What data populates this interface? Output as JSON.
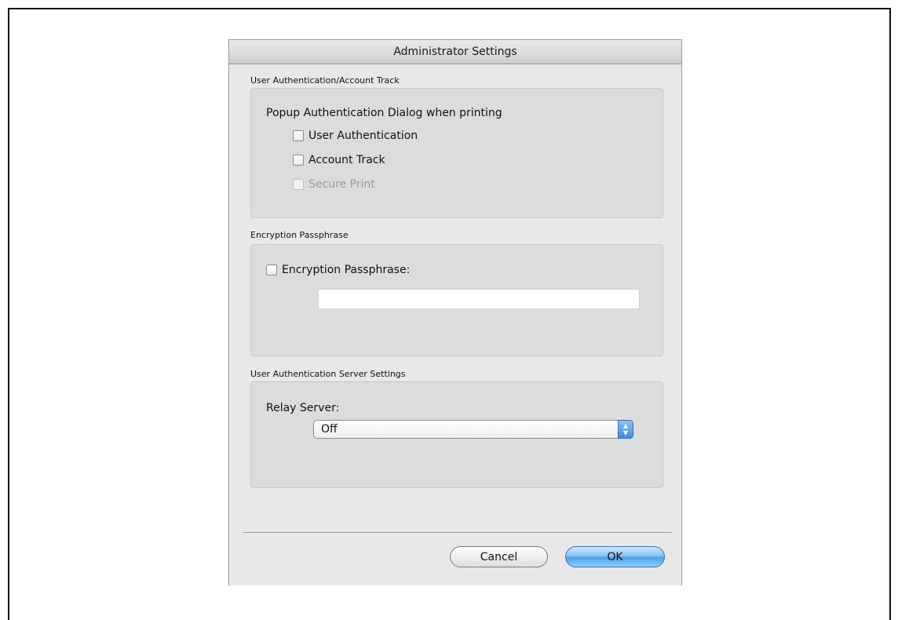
{
  "dialog": {
    "title": "Administrator Settings",
    "sections": {
      "auth": {
        "label": "User Authentication/Account Track",
        "heading": "Popup Authentication Dialog when printing",
        "options": [
          {
            "label": "User Authentication",
            "checked": false,
            "enabled": true
          },
          {
            "label": "Account Track",
            "checked": false,
            "enabled": true
          },
          {
            "label": "Secure Print",
            "checked": false,
            "enabled": false
          }
        ]
      },
      "encryption": {
        "label": "Encryption Passphrase",
        "checkbox_label": "Encryption Passphrase:",
        "checked": false,
        "value": ""
      },
      "server": {
        "label": "User Authentication Server Settings",
        "heading": "Relay Server:",
        "selected": "Off"
      }
    },
    "buttons": {
      "cancel": "Cancel",
      "ok": "OK"
    }
  }
}
